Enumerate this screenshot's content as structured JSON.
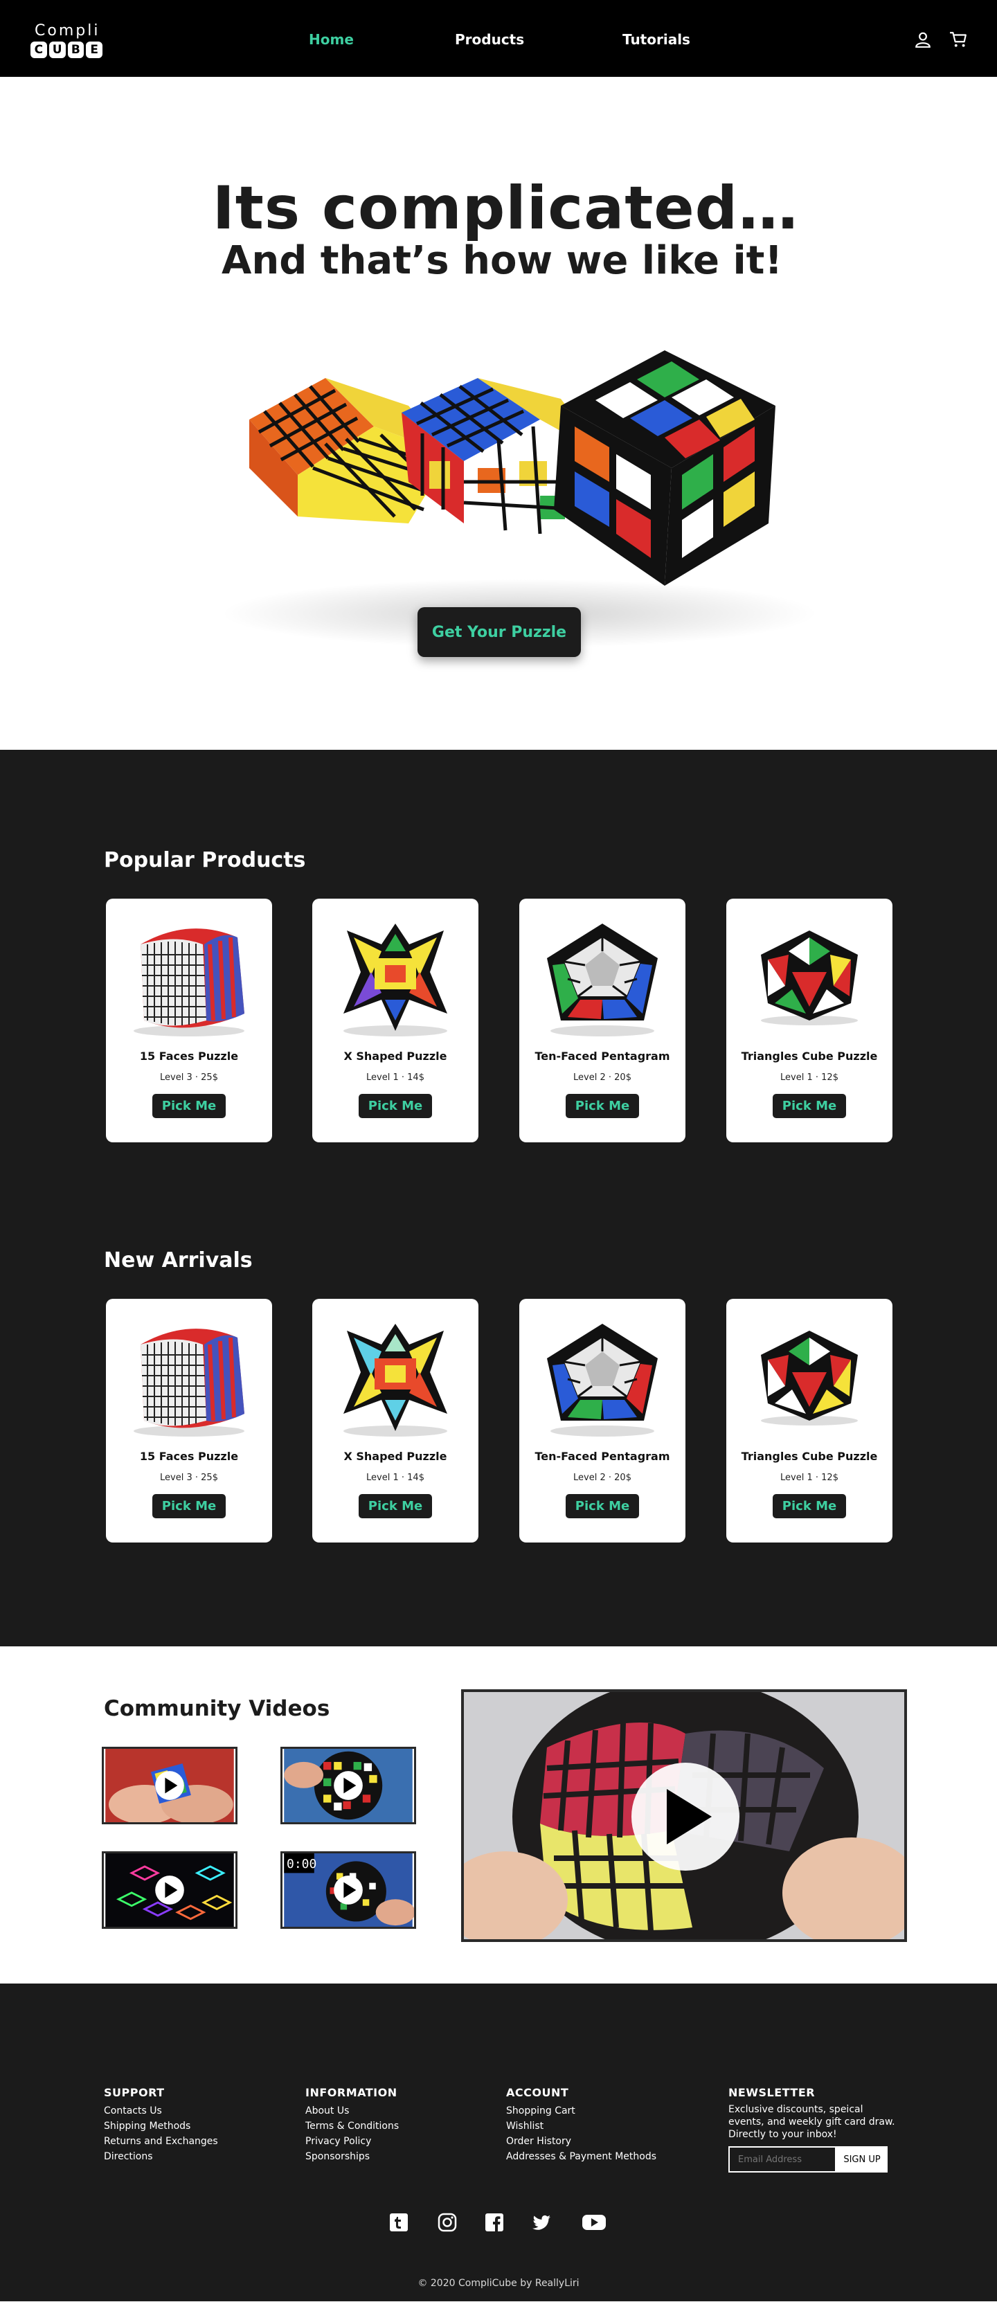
{
  "brand": {
    "top": "Compli",
    "letters": [
      "C",
      "U",
      "B",
      "E"
    ]
  },
  "nav": {
    "links": [
      {
        "label": "Home"
      },
      {
        "label": "Products"
      },
      {
        "label": "Tutorials"
      }
    ]
  },
  "hero": {
    "title": "Its complicated…",
    "subtitle": "And that’s how we like it!",
    "cta": "Get Your Puzzle"
  },
  "popular": {
    "title": "Popular Products",
    "items": [
      {
        "name": "15 Faces Puzzle",
        "meta": "Level 3  ·  25$",
        "button": "Pick Me"
      },
      {
        "name": "X Shaped Puzzle",
        "meta": "Level 1  ·  14$",
        "button": "Pick Me"
      },
      {
        "name": "Ten-Faced Pentagram",
        "meta": "Level 2  ·  20$",
        "button": "Pick Me"
      },
      {
        "name": "Triangles Cube Puzzle",
        "meta": "Level 1  ·  12$",
        "button": "Pick Me"
      }
    ]
  },
  "arrivals": {
    "title": "New Arrivals",
    "items": [
      {
        "name": "15 Faces Puzzle",
        "meta": "Level 3  ·  25$",
        "button": "Pick Me"
      },
      {
        "name": "X Shaped Puzzle",
        "meta": "Level 1  ·  14$",
        "button": "Pick Me"
      },
      {
        "name": "Ten-Faced Pentagram",
        "meta": "Level 2  ·  20$",
        "button": "Pick Me"
      },
      {
        "name": "Triangles Cube Puzzle",
        "meta": "Level 1  ·  12$",
        "button": "Pick Me"
      }
    ]
  },
  "videos": {
    "title": "Community Videos",
    "thumb4_timer": "0:00"
  },
  "footer": {
    "support": {
      "title": "SUPPORT",
      "links": [
        "Contacts Us",
        "Shipping Methods",
        "Returns and Exchanges",
        "Directions"
      ]
    },
    "information": {
      "title": "INFORMATION",
      "links": [
        "About Us",
        "Terms & Conditions",
        "Privacy Policy",
        "Sponsorships"
      ]
    },
    "account": {
      "title": "ACCOUNT",
      "links": [
        "Shopping Cart",
        "Wishlist",
        "Order History",
        "Addresses & Payment Methods"
      ]
    },
    "newsletter": {
      "title": "NEWSLETTER",
      "text": "Exclusive discounts, speical events, and weekly gift card draw. Directly to your inbox!",
      "placeholder": "Email Address",
      "button": "SIGN UP"
    },
    "social_icons": [
      "tumblr-icon",
      "instagram-icon",
      "facebook-icon",
      "twitter-icon",
      "youtube-icon"
    ],
    "copyright": "© 2020 CompliCube by ReallyLiri"
  },
  "colors": {
    "accent": "#3ecfa1",
    "dark": "#1b1b1b",
    "black": "#000000",
    "white": "#ffffff"
  }
}
